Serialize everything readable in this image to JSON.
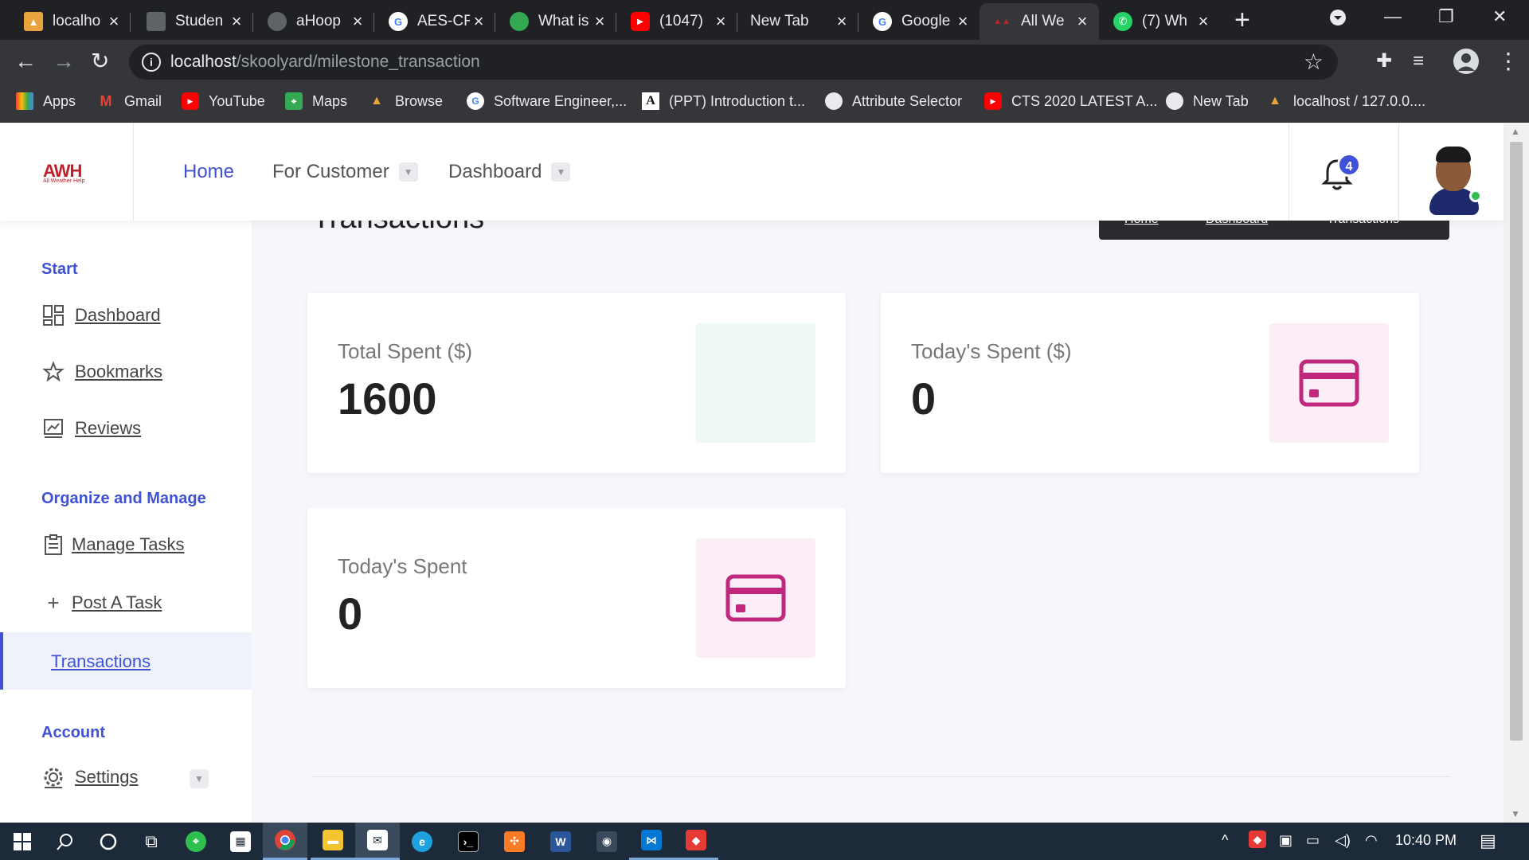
{
  "browser": {
    "tabs": [
      {
        "title": "localho",
        "favicon": "pma-icon",
        "color": "#e8a33d"
      },
      {
        "title": "Studen",
        "favicon": "page-icon",
        "color": "#9aa0a6"
      },
      {
        "title": "aHoop",
        "favicon": "globe-icon",
        "color": "#5f6368"
      },
      {
        "title": "AES-CF",
        "favicon": "google-icon",
        "color": "#4285f4"
      },
      {
        "title": "What is",
        "favicon": "globe-icon",
        "color": "#34a853"
      },
      {
        "title": "(1047)",
        "favicon": "youtube-icon",
        "color": "#ff0000"
      },
      {
        "title": "New Tab",
        "favicon": "",
        "color": ""
      },
      {
        "title": "Google",
        "favicon": "google-icon",
        "color": "#4285f4"
      },
      {
        "title": "All We",
        "favicon": "awh-icon",
        "color": "#c0202a"
      },
      {
        "title": "(7) Wh",
        "favicon": "whatsapp-icon",
        "color": "#25d366"
      }
    ],
    "url_host": "localhost",
    "url_path": "/skoolyard/milestone_transaction",
    "bookmarks": [
      {
        "label": "Apps",
        "icon": "apps-icon",
        "color": "#ea4335"
      },
      {
        "label": "Gmail",
        "icon": "gmail-icon",
        "color": "#ea4335"
      },
      {
        "label": "YouTube",
        "icon": "youtube-icon",
        "color": "#ff0000"
      },
      {
        "label": "Maps",
        "icon": "maps-icon",
        "color": "#34a853"
      },
      {
        "label": "Browse",
        "icon": "pma-icon",
        "color": "#e8a33d"
      },
      {
        "label": "Software Engineer,...",
        "icon": "google-icon",
        "color": "#4285f4"
      },
      {
        "label": "(PPT) Introduction t...",
        "icon": "academia-icon",
        "color": "#ffffff"
      },
      {
        "label": "Attribute Selector",
        "icon": "globe-icon",
        "color": "#9aa0a6"
      },
      {
        "label": "CTS 2020 LATEST A...",
        "icon": "youtube-icon",
        "color": "#ff0000"
      },
      {
        "label": "New Tab",
        "icon": "globe-icon",
        "color": "#9aa0a6"
      },
      {
        "label": "localhost / 127.0.0....",
        "icon": "pma-icon",
        "color": "#e8a33d"
      }
    ]
  },
  "header": {
    "logo_text": "AWH",
    "logo_sub": "All Weather Help",
    "nav": [
      "Home",
      "For Customer",
      "Dashboard"
    ],
    "notification_count": "4"
  },
  "sidebar": {
    "sections": [
      {
        "title": "Start",
        "items": [
          "Dashboard",
          "Bookmarks",
          "Reviews"
        ]
      },
      {
        "title": "Organize and Manage",
        "items": [
          "Manage Tasks",
          "Post A Task",
          "Transactions"
        ]
      },
      {
        "title": "Account",
        "items": [
          "Settings"
        ]
      }
    ],
    "active": "Transactions"
  },
  "main": {
    "page_title": "Transactions",
    "breadcrumb": [
      "Home",
      "Dashboard",
      "Transactions"
    ],
    "cards": [
      {
        "label": "Total Spent ($)",
        "value": "1600"
      },
      {
        "label": "Today's Spent ($)",
        "value": "0"
      },
      {
        "label": "Today's Spent",
        "value": "0"
      }
    ]
  },
  "taskbar": {
    "clock": "10:40 PM"
  },
  "colors": {
    "accent": "#3f51d6",
    "card_icon_pink": "#c0287e",
    "card_icon_bg_pink": "#fbeef6",
    "card_icon_bg_green": "#eef9f3"
  }
}
